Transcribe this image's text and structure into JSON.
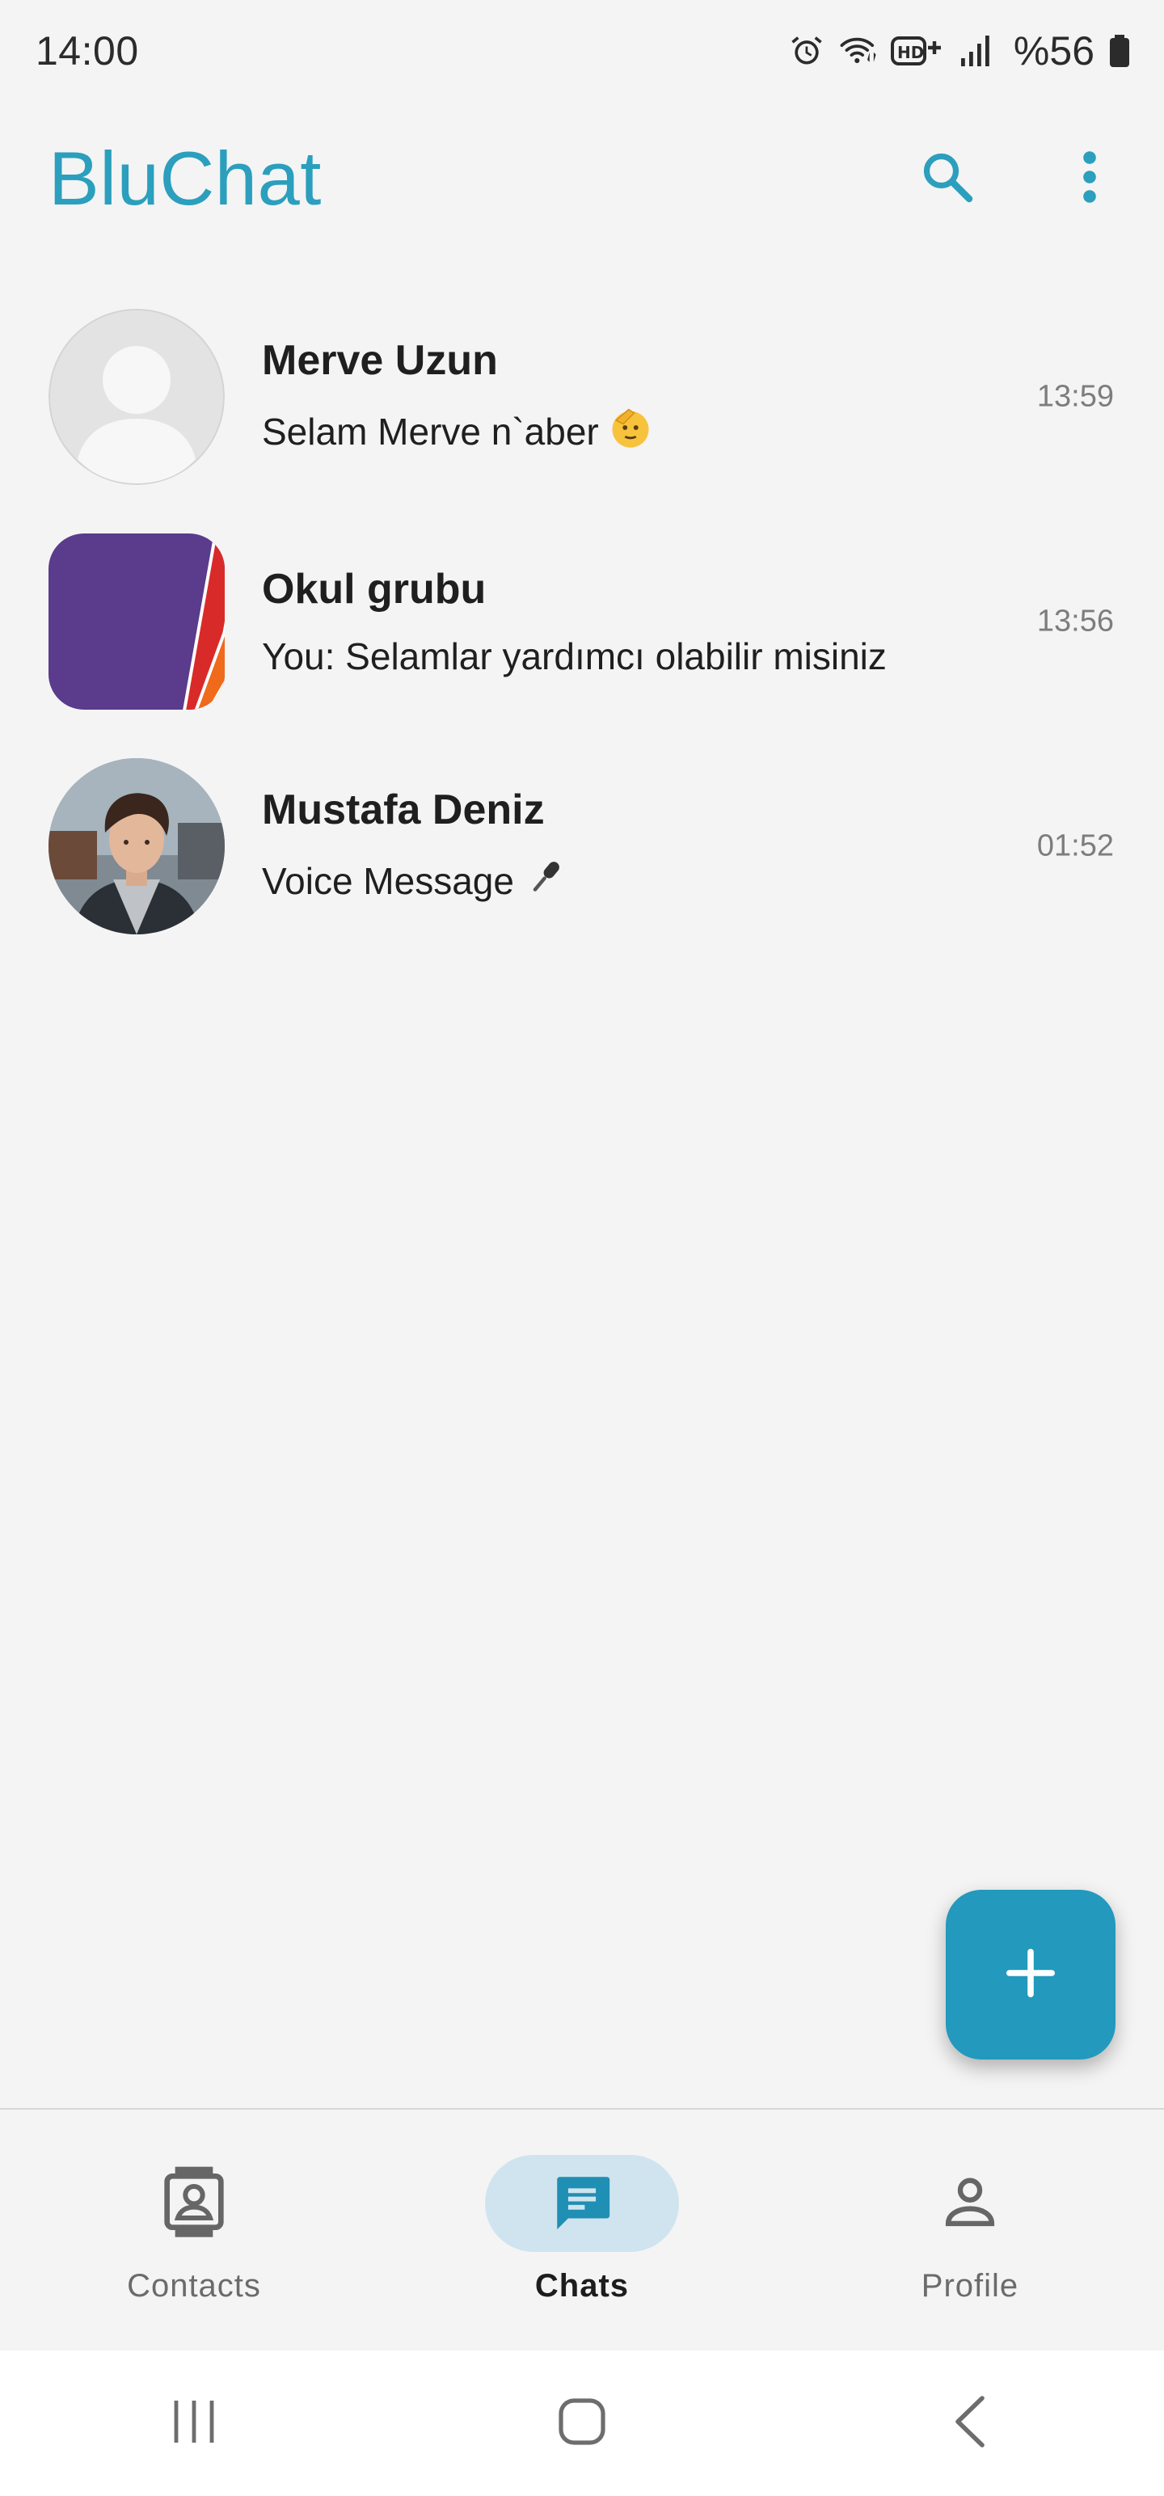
{
  "status_bar": {
    "time": "14:00",
    "battery_text": "%56",
    "icons": [
      "alarm-icon",
      "wifi-icon",
      "hd-plus-icon",
      "signal-icon",
      "battery-icon"
    ]
  },
  "app_bar": {
    "title": "BluChat",
    "actions": [
      "search-icon",
      "more-vert-icon"
    ]
  },
  "colors": {
    "accent": "#2b9fbd",
    "fab": "#2399bd",
    "nav_active_pill": "#cfe4ef",
    "background": "#f4f4f4"
  },
  "chats": [
    {
      "name": "Merve Uzun",
      "preview": "Selam Merve n`aber",
      "preview_emoji": "🫡",
      "time": "13:59",
      "avatar": "default-avatar"
    },
    {
      "name": "Okul grubu",
      "preview": "You: Selamlar yardımcı olabilir misiniz",
      "preview_emoji": "",
      "time": "13:56",
      "avatar": "color-swatch-image"
    },
    {
      "name": "Mustafa Deniz",
      "preview": "Voice Message",
      "preview_emoji": "🎤",
      "time": "01:52",
      "avatar": "profile-photo"
    }
  ],
  "fab": {
    "icon": "plus-icon"
  },
  "bottom_nav": {
    "items": [
      {
        "label": "Contacts",
        "icon": "contacts-icon",
        "active": false
      },
      {
        "label": "Chats",
        "icon": "chat-icon",
        "active": true
      },
      {
        "label": "Profile",
        "icon": "person-icon",
        "active": false
      }
    ]
  },
  "system_nav": [
    "recents-icon",
    "home-icon",
    "back-icon"
  ]
}
